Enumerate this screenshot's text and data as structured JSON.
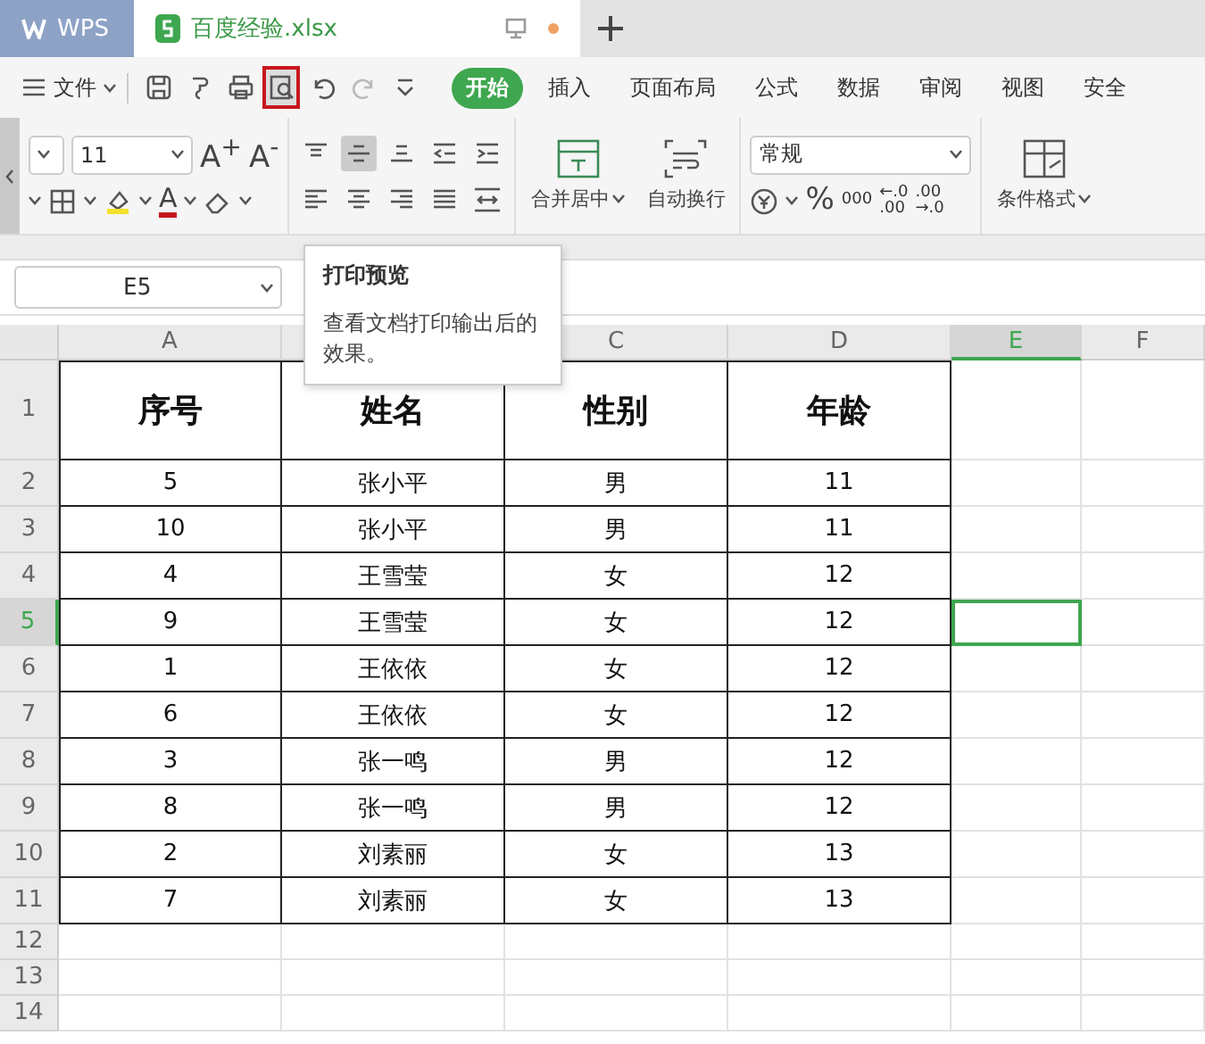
{
  "tabs": [
    {
      "label": "WPS",
      "kind": "home",
      "selected": false
    },
    {
      "label": "百度经验.xlsx",
      "kind": "file",
      "selected": true
    }
  ],
  "file_menu": "文件",
  "quick_tools": [
    {
      "kind": "save",
      "highlighted": false
    },
    {
      "kind": "format-painter",
      "highlighted": false
    },
    {
      "kind": "print",
      "highlighted": false
    },
    {
      "kind": "print-preview",
      "highlighted": true
    },
    {
      "kind": "undo",
      "highlighted": false
    },
    {
      "kind": "redo",
      "highlighted": false
    },
    {
      "kind": "more",
      "highlighted": false
    }
  ],
  "ribbon_tabs": [
    {
      "label": "开始",
      "selected": true
    },
    {
      "label": "插入",
      "selected": false
    },
    {
      "label": "页面布局",
      "selected": false
    },
    {
      "label": "公式",
      "selected": false
    },
    {
      "label": "数据",
      "selected": false
    },
    {
      "label": "审阅",
      "selected": false
    },
    {
      "label": "视图",
      "selected": false
    },
    {
      "label": "安全",
      "selected": false
    }
  ],
  "ribbon": {
    "font_size": "11",
    "grow_font": "A$^{+}$",
    "shrink_font": "A$^{-}$",
    "font_color": "A",
    "alignment": [
      {
        "kind": "top",
        "selected": false
      },
      {
        "kind": "middle",
        "selected": true
      },
      {
        "kind": "bottom",
        "selected": false
      },
      {
        "kind": "outdent",
        "selected": false
      },
      {
        "kind": "indent",
        "selected": false
      },
      {
        "kind": "left",
        "selected": false
      },
      {
        "kind": "center",
        "selected": false
      },
      {
        "kind": "right",
        "selected": false
      },
      {
        "kind": "justify",
        "selected": false
      },
      {
        "kind": "distribute",
        "selected": false
      }
    ],
    "merge": "合并居中",
    "wrap": "自动换行",
    "number_format": "常规",
    "percent": "%",
    "thousands": "000",
    "decimal_more": [
      "←.0",
      ".00"
    ],
    "decimal_less": [
      ".00",
      "→.0"
    ],
    "conditional": "条件格式"
  },
  "name_box": "E5",
  "tooltip": {
    "title": "打印预览",
    "text": "查看文档打印输出后的效果。"
  },
  "columns": [
    {
      "label": "A",
      "selected": false
    },
    {
      "selected": false
    },
    {
      "label": "C",
      "selected": false
    },
    {
      "label": "D",
      "selected": false
    },
    {
      "label": "E",
      "selected": true
    },
    {
      "label": "F",
      "selected": false
    }
  ],
  "rows": [
    {
      "number": "1",
      "kind": "header",
      "selected": false,
      "cells": [
        "序号",
        "姓名",
        "性别",
        "年龄"
      ]
    },
    {
      "number": "2",
      "kind": "data",
      "selected": false,
      "cells": [
        "5",
        "张小平",
        "男",
        "11"
      ]
    },
    {
      "number": "3",
      "kind": "data",
      "selected": false,
      "cells": [
        "10",
        "张小平",
        "男",
        "11"
      ]
    },
    {
      "number": "4",
      "kind": "data",
      "selected": false,
      "cells": [
        "4",
        "王雪莹",
        "女",
        "12"
      ]
    },
    {
      "number": "5",
      "kind": "data",
      "selected": true,
      "cells": [
        "9",
        "王雪莹",
        "女",
        "12"
      ]
    },
    {
      "number": "6",
      "kind": "data",
      "selected": false,
      "cells": [
        "1",
        "王依依",
        "女",
        "12"
      ]
    },
    {
      "number": "7",
      "kind": "data",
      "selected": false,
      "cells": [
        "6",
        "王依依",
        "女",
        "12"
      ]
    },
    {
      "number": "8",
      "kind": "data",
      "selected": false,
      "cells": [
        "3",
        "张一鸣",
        "男",
        "12"
      ]
    },
    {
      "number": "9",
      "kind": "data",
      "selected": false,
      "cells": [
        "8",
        "张一鸣",
        "男",
        "12"
      ]
    },
    {
      "number": "10",
      "kind": "data",
      "selected": false,
      "cells": [
        "2",
        "刘素丽",
        "女",
        "13"
      ]
    },
    {
      "number": "11",
      "kind": "data",
      "selected": false,
      "cells": [
        "7",
        "刘素丽",
        "女",
        "13"
      ]
    },
    {
      "number": "12",
      "kind": "empty",
      "selected": false
    },
    {
      "number": "13",
      "kind": "empty",
      "selected": false
    },
    {
      "number": "14",
      "kind": "empty",
      "selected": false
    }
  ]
}
